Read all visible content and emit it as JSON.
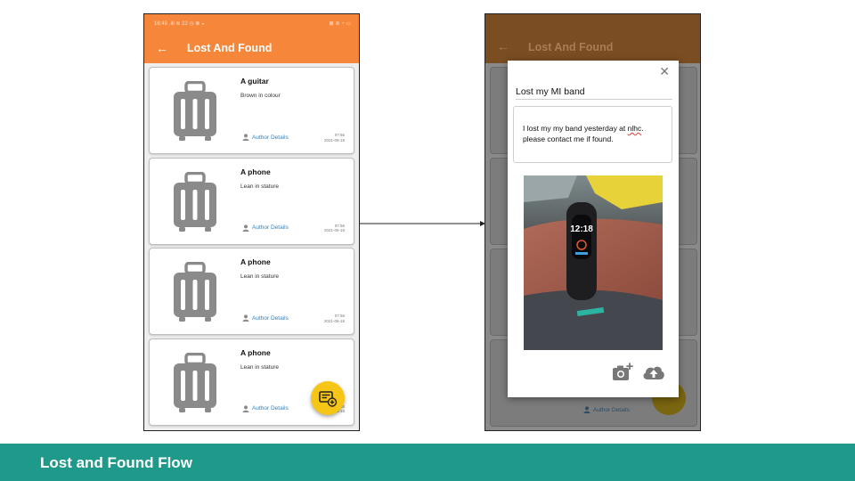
{
  "footer": {
    "title": "Lost and Found Flow"
  },
  "phone1": {
    "status_left": "16:49 .ıll ≋ 22 ◷ ⊗ ◒",
    "status_right": "⊠ ⊘ ◔ ▭",
    "back_icon": "arrow-back-icon",
    "app_title": "Lost And Found",
    "items": [
      {
        "title": "A guitar",
        "description": "Brown in colour",
        "author_label": "Author Details",
        "time": "07:56",
        "date": "2021-05-18"
      },
      {
        "title": "A phone",
        "description": "Lean in stature",
        "author_label": "Author Details",
        "time": "07:56",
        "date": "2021-05-18"
      },
      {
        "title": "A phone",
        "description": "Lean in stature",
        "author_label": "Author Details",
        "time": "07:56",
        "date": "2021-05-18"
      },
      {
        "title": "A phone",
        "description": "Lean in stature",
        "author_label": "Author Details",
        "time": "07:56",
        "date": "2021-05-18"
      }
    ],
    "fab_icon": "add-post-icon"
  },
  "phone2": {
    "app_title": "Lost And Found",
    "bg_author_label": "Author Details",
    "dialog": {
      "close_icon": "close-icon",
      "title_value": "Lost my MI band",
      "body_before": "I lost my my band yesterday at ",
      "body_misspelled": "nlhc",
      "body_after": ". please contact me if found.",
      "photo_icon": "add-photo-icon",
      "upload_icon": "cloud-upload-icon"
    }
  },
  "colors": {
    "accent": "#f5863a",
    "fab": "#f5c518",
    "link": "#2f83c5",
    "footer": "#1f9a8a"
  }
}
